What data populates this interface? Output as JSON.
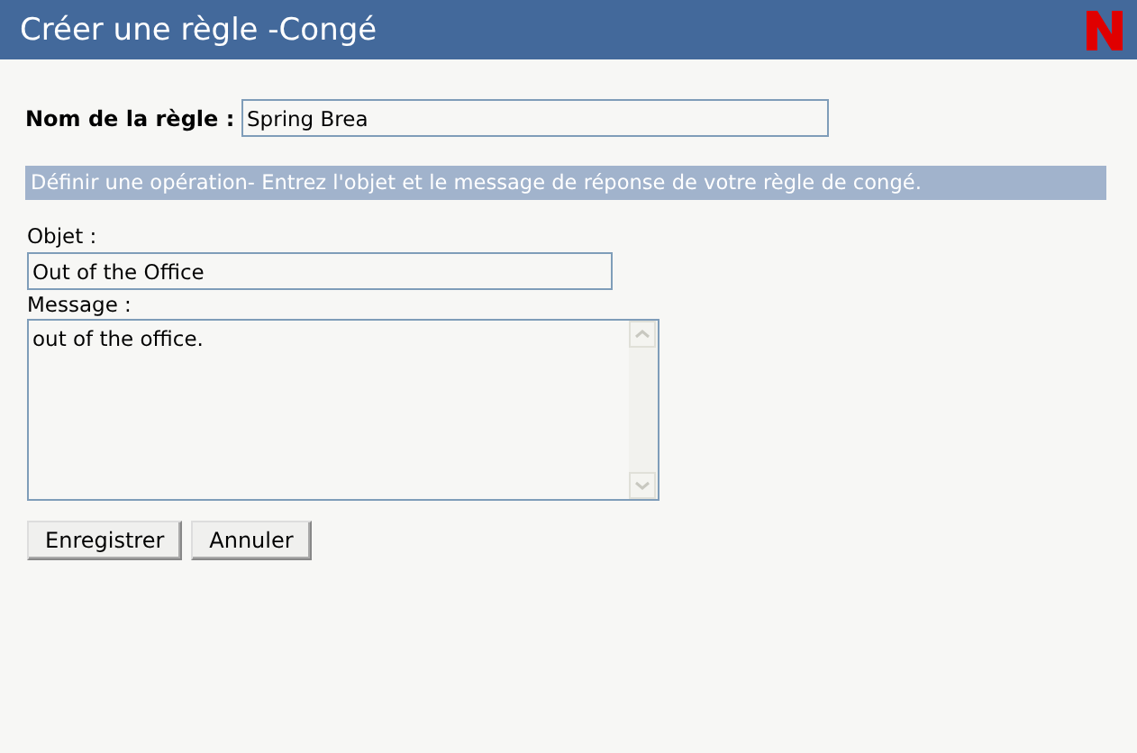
{
  "window": {
    "title": "Créer une règle -Congé"
  },
  "rule_name": {
    "label": "Nom de la règle :",
    "value": "Spring Brea"
  },
  "banner": "Définir une opération- Entrez l'objet et le message de réponse de votre règle de congé.",
  "subject": {
    "label": "Objet :",
    "value": "Out of the Office"
  },
  "message": {
    "label": "Message :",
    "value": "out of the office."
  },
  "buttons": [
    "Enregistrer",
    "Annuler"
  ]
}
